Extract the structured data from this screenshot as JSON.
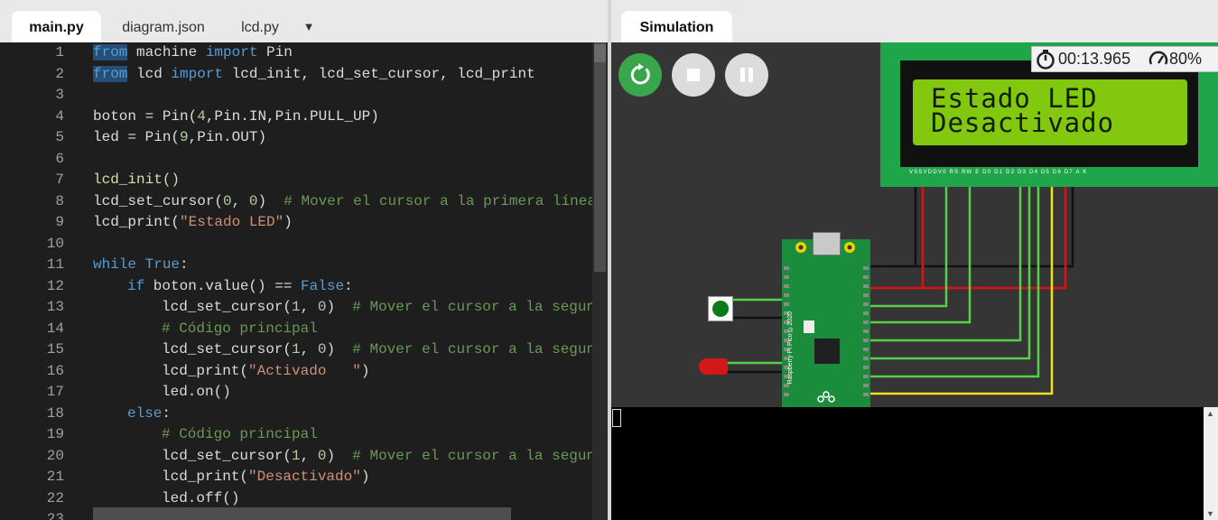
{
  "editor": {
    "tabs": [
      {
        "label": "main.py",
        "active": true
      },
      {
        "label": "diagram.json",
        "active": false
      },
      {
        "label": "lcd.py",
        "active": false
      }
    ],
    "code_lines": [
      {
        "num": "1"
      },
      {
        "num": "2"
      },
      {
        "num": "3"
      },
      {
        "num": "4"
      },
      {
        "num": "5"
      },
      {
        "num": "6"
      },
      {
        "num": "7"
      },
      {
        "num": "8"
      },
      {
        "num": "9"
      },
      {
        "num": "10"
      },
      {
        "num": "11"
      },
      {
        "num": "12"
      },
      {
        "num": "13"
      },
      {
        "num": "14"
      },
      {
        "num": "15"
      },
      {
        "num": "16"
      },
      {
        "num": "17"
      },
      {
        "num": "18"
      },
      {
        "num": "19"
      },
      {
        "num": "20"
      },
      {
        "num": "21"
      },
      {
        "num": "22"
      },
      {
        "num": "23"
      }
    ],
    "code": {
      "l1_kw1": "from",
      "l1_t1": " machine ",
      "l1_kw2": "import",
      "l1_t2": " Pin",
      "l2_kw1": "from",
      "l2_t1": " lcd ",
      "l2_kw2": "import",
      "l2_t2": " lcd_init, lcd_set_cursor, lcd_print",
      "l4_t1": "boton = Pin(",
      "l4_n1": "4",
      "l4_t2": ",Pin.IN,Pin.PULL_UP)",
      "l5_t1": "led = Pin(",
      "l5_n1": "9",
      "l5_t2": ",Pin.OUT)",
      "l7_t1": "lcd_init()",
      "l8_t1": "lcd_set_cursor(",
      "l8_n1": "0",
      "l8_t2": ", ",
      "l8_n2": "0",
      "l8_t3": ")  ",
      "l8_c1": "# Mover el cursor a la primera línea",
      "l9_t1": "lcd_print(",
      "l9_s1": "\"Estado LED\"",
      "l9_t2": ")",
      "l11_kw1": "while",
      "l11_t1": " ",
      "l11_kw2": "True",
      "l11_t2": ":",
      "l12_kw1": "if",
      "l12_t1": " boton.value() == ",
      "l12_kw2": "False",
      "l12_t2": ":",
      "l13_t1": "lcd_set_cursor(",
      "l13_n1": "1",
      "l13_t2": ", ",
      "l13_n2": "0",
      "l13_t3": ")  ",
      "l13_c1": "# Mover el cursor a la segunda",
      "l14_c1": "# Código principal",
      "l15_t1": "lcd_set_cursor(",
      "l15_n1": "1",
      "l15_t2": ", ",
      "l15_n2": "0",
      "l15_t3": ")  ",
      "l15_c1": "# Mover el cursor a la segunda",
      "l16_t1": "lcd_print(",
      "l16_s1": "\"Activado   \"",
      "l16_t2": ")",
      "l17_t1": "led.on()",
      "l18_kw1": "else",
      "l18_t1": ":",
      "l19_c1": "# Código principal",
      "l20_t1": "lcd_set_cursor(",
      "l20_n1": "1",
      "l20_t2": ", ",
      "l20_n2": "0",
      "l20_t3": ")  ",
      "l20_c1": "# Mover el cursor a la segunda",
      "l21_t1": "lcd_print(",
      "l21_s1": "\"Desactivado\"",
      "l21_t2": ")",
      "l22_t1": "led.off()"
    }
  },
  "simulation": {
    "tab_label": "Simulation",
    "timer": "00:13.965",
    "speed": "80%",
    "lcd": {
      "row1": "Estado LED",
      "row2": "Desactivado",
      "pin_labels": "VSSVDDV0 RS RW E D0 D1 D2 D3 D4 D5 D6 D7 A K"
    },
    "board_label": "Raspberry Pi Pico ©2020"
  },
  "icons": {
    "restart": "restart-icon",
    "stop": "stop-icon",
    "pause": "pause-icon",
    "timer": "stopwatch-icon",
    "speed": "speedometer-icon",
    "dropdown": "chevron-down-icon"
  },
  "colors": {
    "run_button": "#3aa64c",
    "lcd_backlight": "#82c80e",
    "board": "#1b8c3c",
    "wire_red": "#e01010",
    "wire_green": "#55d04a",
    "wire_yellow": "#f2e01a"
  }
}
